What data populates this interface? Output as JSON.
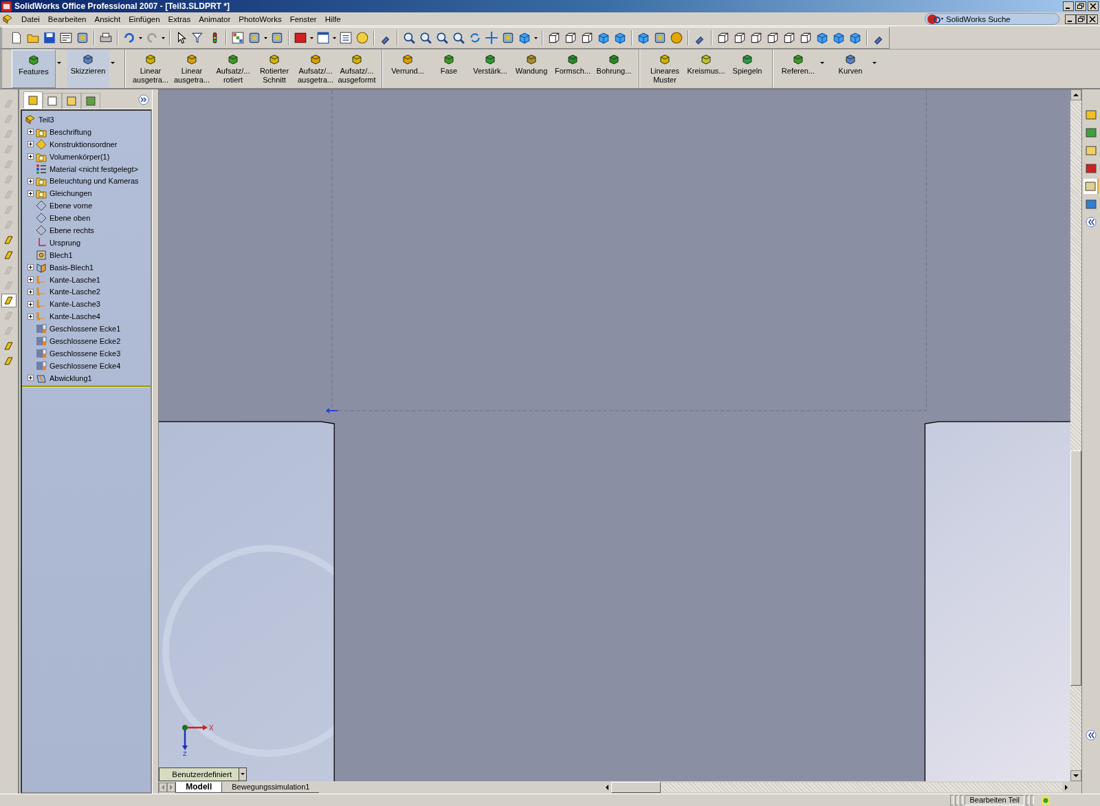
{
  "window": {
    "title": "SolidWorks Office Professional 2007 - [Teil3.SLDPRT *]"
  },
  "menu": [
    "Datei",
    "Bearbeiten",
    "Ansicht",
    "Einfügen",
    "Extras",
    "Animator",
    "PhotoWorks",
    "Fenster",
    "Hilfe"
  ],
  "search": {
    "placeholder": "SolidWorks Suche"
  },
  "command_groups": [
    {
      "items": [
        {
          "lines": [
            "Features"
          ],
          "selected": true,
          "dropdown": true
        },
        {
          "lines": [
            "Skizzieren"
          ],
          "selected": false,
          "dropdown": true
        }
      ]
    },
    {
      "items": [
        {
          "lines": [
            "Linear",
            "ausgetra..."
          ],
          "selected": false
        },
        {
          "lines": [
            "Linear",
            "ausgetra..."
          ],
          "selected": false
        },
        {
          "lines": [
            "Aufsatz/...",
            "rotiert"
          ],
          "selected": false
        },
        {
          "lines": [
            "Rotierter",
            "Schnitt"
          ],
          "selected": false
        },
        {
          "lines": [
            "Aufsatz/...",
            "ausgetra..."
          ],
          "selected": false
        },
        {
          "lines": [
            "Aufsatz/...",
            "ausgeformt"
          ],
          "selected": false
        }
      ]
    },
    {
      "items": [
        {
          "lines": [
            "Verrund..."
          ],
          "selected": false
        },
        {
          "lines": [
            "Fase"
          ],
          "selected": false
        },
        {
          "lines": [
            "Verstärk..."
          ],
          "selected": false
        },
        {
          "lines": [
            "Wandung"
          ],
          "selected": false
        },
        {
          "lines": [
            "Formsch..."
          ],
          "selected": false
        },
        {
          "lines": [
            "Bohrung..."
          ],
          "selected": false
        }
      ]
    },
    {
      "items": [
        {
          "lines": [
            "Lineares",
            "Muster"
          ],
          "selected": false
        },
        {
          "lines": [
            "Kreismus..."
          ],
          "selected": false
        },
        {
          "lines": [
            "Spiegeln"
          ],
          "selected": false
        }
      ]
    },
    {
      "items": [
        {
          "lines": [
            "Referen..."
          ],
          "selected": false,
          "dropdown": true
        },
        {
          "lines": [
            "Kurven"
          ],
          "selected": false,
          "dropdown": true
        }
      ]
    }
  ],
  "left_toolbar": [
    {
      "disabled": true,
      "selected": false
    },
    {
      "disabled": true,
      "selected": false
    },
    {
      "disabled": true,
      "selected": false
    },
    {
      "disabled": true,
      "selected": false
    },
    {
      "disabled": true,
      "selected": false
    },
    {
      "disabled": true,
      "selected": false
    },
    {
      "disabled": true,
      "selected": false
    },
    {
      "disabled": true,
      "selected": false
    },
    {
      "disabled": true,
      "selected": false
    },
    {
      "disabled": false,
      "selected": false
    },
    {
      "disabled": false,
      "selected": false
    },
    {
      "disabled": true,
      "selected": false
    },
    {
      "disabled": true,
      "selected": false
    },
    {
      "disabled": false,
      "selected": true
    },
    {
      "disabled": true,
      "selected": false
    },
    {
      "disabled": true,
      "selected": false
    },
    {
      "disabled": false,
      "selected": false
    },
    {
      "disabled": false,
      "selected": false
    }
  ],
  "panel_tabs": [
    {
      "selected": true
    },
    {
      "selected": false
    },
    {
      "selected": false
    },
    {
      "selected": false
    }
  ],
  "tree": {
    "root": "Teil3",
    "items": [
      {
        "label": "Beschriftung",
        "kind": "folder",
        "expandable": true
      },
      {
        "label": "Konstruktionsordner",
        "kind": "diamond",
        "expandable": true
      },
      {
        "label": "Volumenkörper(1)",
        "kind": "folder",
        "expandable": true
      },
      {
        "label": "Material <nicht festgelegt>",
        "kind": "material",
        "expandable": false
      },
      {
        "label": "Beleuchtung und Kameras",
        "kind": "folder",
        "expandable": true
      },
      {
        "label": "Gleichungen",
        "kind": "folder",
        "expandable": true
      },
      {
        "label": "Ebene vorne",
        "kind": "plane",
        "expandable": false
      },
      {
        "label": "Ebene oben",
        "kind": "plane",
        "expandable": false
      },
      {
        "label": "Ebene rechts",
        "kind": "plane",
        "expandable": false
      },
      {
        "label": "Ursprung",
        "kind": "origin",
        "expandable": false
      },
      {
        "label": "Blech1",
        "kind": "sheet",
        "expandable": false
      },
      {
        "label": "Basis-Blech1",
        "kind": "base",
        "expandable": true
      },
      {
        "label": "Kante-Lasche1",
        "kind": "flange",
        "expandable": true
      },
      {
        "label": "Kante-Lasche2",
        "kind": "flange",
        "expandable": true
      },
      {
        "label": "Kante-Lasche3",
        "kind": "flange",
        "expandable": true
      },
      {
        "label": "Kante-Lasche4",
        "kind": "flange",
        "expandable": true
      },
      {
        "label": "Geschlossene Ecke1",
        "kind": "corner",
        "expandable": false
      },
      {
        "label": "Geschlossene Ecke2",
        "kind": "corner",
        "expandable": false
      },
      {
        "label": "Geschlossene Ecke3",
        "kind": "corner",
        "expandable": false
      },
      {
        "label": "Geschlossene Ecke4",
        "kind": "corner",
        "expandable": false
      },
      {
        "label": "Abwicklung1",
        "kind": "flatten",
        "expandable": true
      }
    ]
  },
  "triad": {
    "x_label": "X",
    "z_label": "Z"
  },
  "view_orientation": "Benutzerdefiniert",
  "bottom_tabs": [
    {
      "label": "Modell",
      "selected": true
    },
    {
      "label": "Bewegungssimulation1",
      "selected": false
    }
  ],
  "status_bar": {
    "mode": "Bearbeiten Teil"
  }
}
